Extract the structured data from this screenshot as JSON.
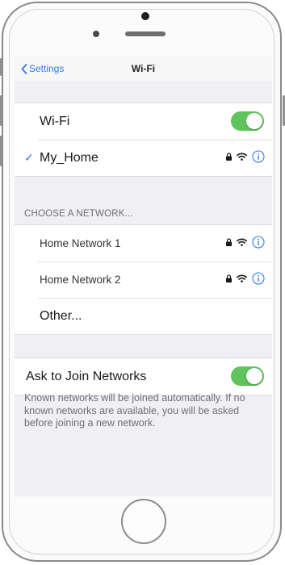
{
  "navbar": {
    "back_label": "Settings",
    "title": "Wi-Fi"
  },
  "wifi": {
    "label": "Wi-Fi",
    "enabled": true
  },
  "connected": {
    "name": "My_Home",
    "icons": [
      "checkmark-icon",
      "lock-icon",
      "wifi-icon",
      "info-icon"
    ]
  },
  "section_header": "CHOOSE A NETWORK...",
  "networks": [
    {
      "name": "Home Network 1",
      "icons": [
        "lock-icon",
        "wifi-icon",
        "info-icon"
      ]
    },
    {
      "name": "Home Network 2",
      "icons": [
        "lock-icon",
        "wifi-icon",
        "info-icon"
      ]
    }
  ],
  "other_label": "Other...",
  "ask_join": {
    "label": "Ask to Join Networks",
    "enabled": true
  },
  "footer": "Known networks will be joined automatically. If no known networks are available, you will be asked before joining a new network.",
  "colors": {
    "accent": "#2F7AF5",
    "toggle_on": "#5FC45C",
    "background": "#EFEFF4",
    "secondary_text": "#6E6E73"
  }
}
